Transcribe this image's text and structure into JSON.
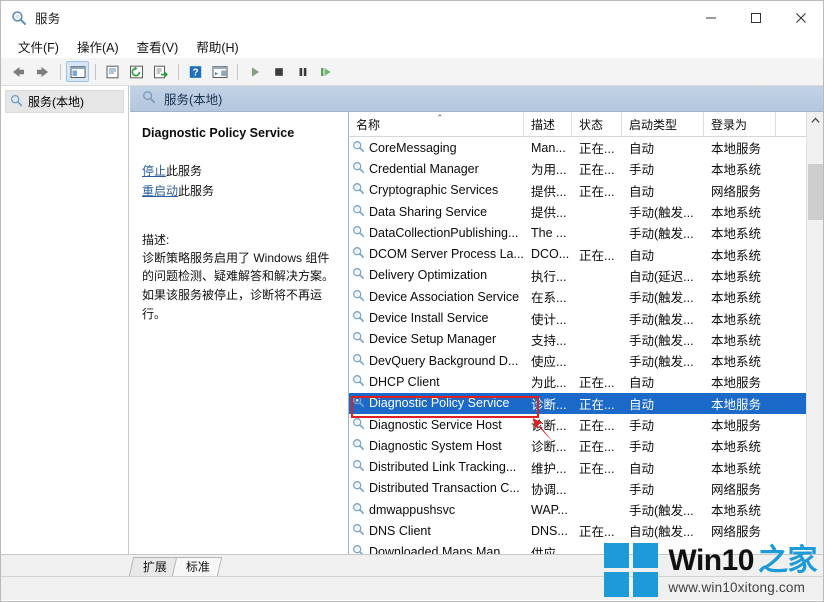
{
  "window": {
    "title": "服务",
    "title_icon": "services-gear-icon",
    "minimize_label": "−",
    "maximize_label": "□",
    "close_label": "✕"
  },
  "menubar": {
    "items": [
      {
        "label": "文件(F)",
        "name": "menu-file"
      },
      {
        "label": "操作(A)",
        "name": "menu-action"
      },
      {
        "label": "查看(V)",
        "name": "menu-view"
      },
      {
        "label": "帮助(H)",
        "name": "menu-help"
      }
    ]
  },
  "toolbar": {
    "buttons": [
      {
        "icon": "back-arrow-icon",
        "name": "toolbar-back"
      },
      {
        "icon": "forward-arrow-icon",
        "name": "toolbar-forward"
      },
      {
        "icon": "show-tree-icon",
        "name": "toolbar-show-console-tree"
      },
      {
        "icon": "properties-icon",
        "name": "toolbar-properties"
      },
      {
        "icon": "refresh-icon",
        "name": "toolbar-refresh"
      },
      {
        "icon": "export-list-icon",
        "name": "toolbar-export-list"
      },
      {
        "icon": "help-icon",
        "name": "toolbar-help"
      },
      {
        "icon": "show-hide-pane-icon",
        "name": "toolbar-show-hide-action-pane"
      },
      {
        "icon": "start-service-icon",
        "name": "toolbar-start-service"
      },
      {
        "icon": "stop-service-icon",
        "name": "toolbar-stop-service"
      },
      {
        "icon": "pause-service-icon",
        "name": "toolbar-pause-service"
      },
      {
        "icon": "restart-service-icon",
        "name": "toolbar-restart-service"
      }
    ]
  },
  "tree": {
    "node_label": "服务(本地)",
    "node_icon": "services-gear-icon"
  },
  "pane_header": {
    "label": "服务(本地)",
    "icon": "services-gear-icon"
  },
  "detail": {
    "service_title": "Diagnostic Policy Service",
    "links": [
      {
        "link_text": "停止",
        "suffix": "此服务",
        "name": "stop-service-link"
      },
      {
        "link_text": "重启动",
        "suffix": "此服务",
        "name": "restart-service-link"
      }
    ],
    "description_label": "描述:",
    "description": "诊断策略服务启用了 Windows 组件的问题检测、疑难解答和解决方案。如果该服务被停止，诊断将不再运行。"
  },
  "list": {
    "columns": [
      {
        "label": "名称",
        "key": "name",
        "sorted": true,
        "sort_mark": "⌃"
      },
      {
        "label": "描述",
        "key": "description"
      },
      {
        "label": "状态",
        "key": "status"
      },
      {
        "label": "启动类型",
        "key": "startup"
      },
      {
        "label": "登录为",
        "key": "logon"
      }
    ],
    "rows": [
      {
        "name": "CoreMessaging",
        "description": "Man...",
        "status": "正在...",
        "startup": "自动",
        "logon": "本地服务",
        "selected": false
      },
      {
        "name": "Credential Manager",
        "description": "为用...",
        "status": "正在...",
        "startup": "手动",
        "logon": "本地系统",
        "selected": false
      },
      {
        "name": "Cryptographic Services",
        "description": "提供...",
        "status": "正在...",
        "startup": "自动",
        "logon": "网络服务",
        "selected": false
      },
      {
        "name": "Data Sharing Service",
        "description": "提供...",
        "status": "",
        "startup": "手动(触发...",
        "logon": "本地系统",
        "selected": false
      },
      {
        "name": "DataCollectionPublishing...",
        "description": "The ...",
        "status": "",
        "startup": "手动(触发...",
        "logon": "本地系统",
        "selected": false
      },
      {
        "name": "DCOM Server Process La...",
        "description": "DCO...",
        "status": "正在...",
        "startup": "自动",
        "logon": "本地系统",
        "selected": false
      },
      {
        "name": "Delivery Optimization",
        "description": "执行...",
        "status": "",
        "startup": "自动(延迟...",
        "logon": "本地系统",
        "selected": false
      },
      {
        "name": "Device Association Service",
        "description": "在系...",
        "status": "",
        "startup": "手动(触发...",
        "logon": "本地系统",
        "selected": false
      },
      {
        "name": "Device Install Service",
        "description": "使计...",
        "status": "",
        "startup": "手动(触发...",
        "logon": "本地系统",
        "selected": false
      },
      {
        "name": "Device Setup Manager",
        "description": "支持...",
        "status": "",
        "startup": "手动(触发...",
        "logon": "本地系统",
        "selected": false
      },
      {
        "name": "DevQuery Background D...",
        "description": "使应...",
        "status": "",
        "startup": "手动(触发...",
        "logon": "本地系统",
        "selected": false
      },
      {
        "name": "DHCP Client",
        "description": "为此...",
        "status": "正在...",
        "startup": "自动",
        "logon": "本地服务",
        "selected": false
      },
      {
        "name": "Diagnostic Policy Service",
        "description": "诊断...",
        "status": "正在...",
        "startup": "自动",
        "logon": "本地服务",
        "selected": true
      },
      {
        "name": "Diagnostic Service Host",
        "description": "诊断...",
        "status": "正在...",
        "startup": "手动",
        "logon": "本地服务",
        "selected": false
      },
      {
        "name": "Diagnostic System Host",
        "description": "诊断...",
        "status": "正在...",
        "startup": "手动",
        "logon": "本地系统",
        "selected": false
      },
      {
        "name": "Distributed Link Tracking...",
        "description": "维护...",
        "status": "正在...",
        "startup": "自动",
        "logon": "本地系统",
        "selected": false
      },
      {
        "name": "Distributed Transaction C...",
        "description": "协调...",
        "status": "",
        "startup": "手动",
        "logon": "网络服务",
        "selected": false
      },
      {
        "name": "dmwappushsvc",
        "description": "WAP...",
        "status": "",
        "startup": "手动(触发...",
        "logon": "本地系统",
        "selected": false
      },
      {
        "name": "DNS Client",
        "description": "DNS...",
        "status": "正在...",
        "startup": "自动(触发...",
        "logon": "网络服务",
        "selected": false
      },
      {
        "name": "Downloaded Maps Man...",
        "description": "供应...",
        "status": "",
        "startup": "",
        "logon": "",
        "selected": false
      }
    ],
    "scrollbar": {
      "up_arrow": "⌃",
      "down_arrow": "⌄"
    }
  },
  "tabs": [
    {
      "label": "扩展",
      "name": "tab-extended",
      "active": false
    },
    {
      "label": "标准",
      "name": "tab-standard",
      "active": true
    }
  ],
  "watermark": {
    "brand": "Win10",
    "brand_cn": "之家",
    "url": "www.win10xitong.com",
    "logo_color": "#1d9bd8"
  },
  "colors": {
    "selection": "#1b6ac9",
    "annotation": "#e02020",
    "pane_header": "#b3c6dd",
    "link": "#2a5d9c"
  }
}
